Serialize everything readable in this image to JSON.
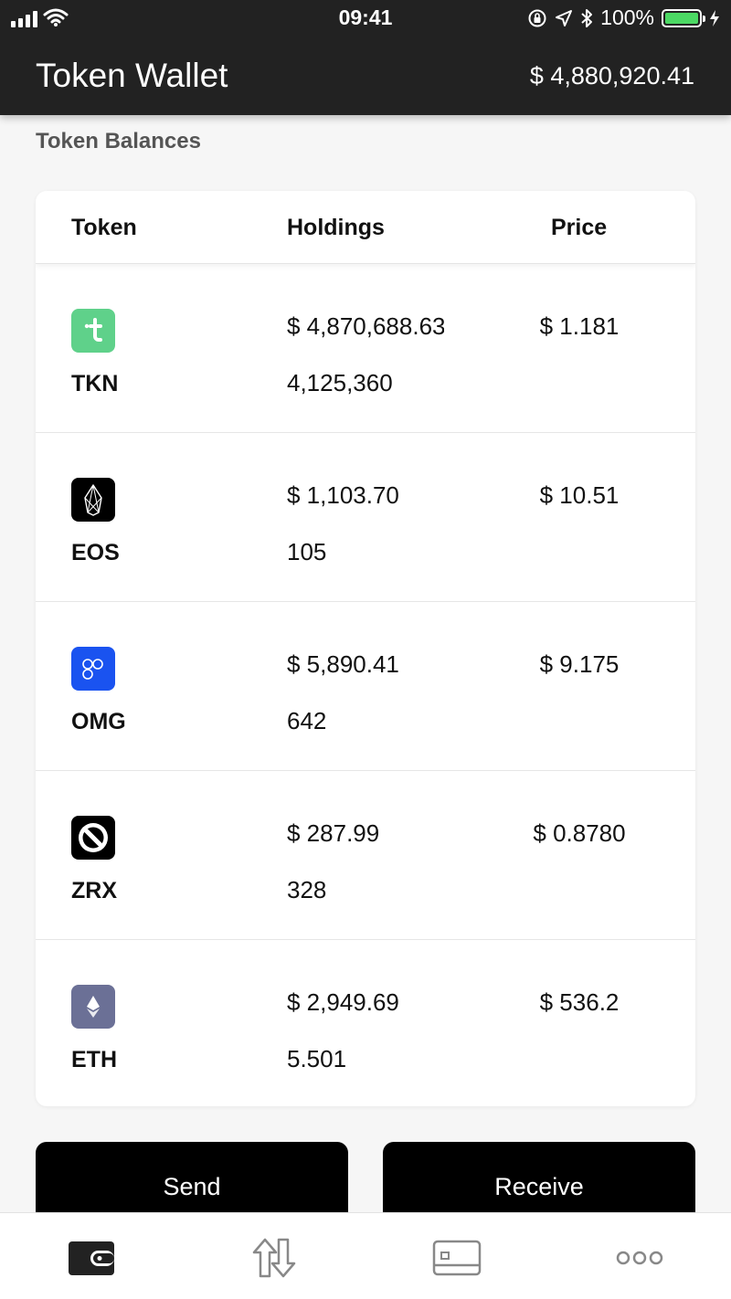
{
  "status_bar": {
    "time": "09:41",
    "battery": "100%"
  },
  "header": {
    "title": "Token Wallet",
    "total": "$ 4,880,920.41"
  },
  "section_title": "Token Balances",
  "table": {
    "headers": {
      "token": "Token",
      "holdings": "Holdings",
      "price": "Price"
    },
    "rows": [
      {
        "symbol": "TKN",
        "usd": "$ 4,870,688.63",
        "qty": "4,125,360",
        "price": "$ 1.181",
        "icon": "tkn-icon",
        "color": "#5fd18a"
      },
      {
        "symbol": "EOS",
        "usd": "$ 1,103.70",
        "qty": "105",
        "price": "$ 10.51",
        "icon": "eos-icon",
        "color": "#000000"
      },
      {
        "symbol": "OMG",
        "usd": "$ 5,890.41",
        "qty": "642",
        "price": "$ 9.175",
        "icon": "omg-icon",
        "color": "#1a53f0"
      },
      {
        "symbol": "ZRX",
        "usd": "$ 287.99",
        "qty": "328",
        "price": "$ 0.8780",
        "icon": "zrx-icon",
        "color": "#000000"
      },
      {
        "symbol": "ETH",
        "usd": "$ 2,949.69",
        "qty": "5.501",
        "price": "$ 536.2",
        "icon": "eth-icon",
        "color": "#6b7096"
      }
    ]
  },
  "actions": {
    "send_label": "Send",
    "receive_label": "Receive"
  },
  "tabbar": {
    "items": [
      "wallet-icon",
      "transfer-icon",
      "card-icon",
      "more-icon"
    ]
  }
}
